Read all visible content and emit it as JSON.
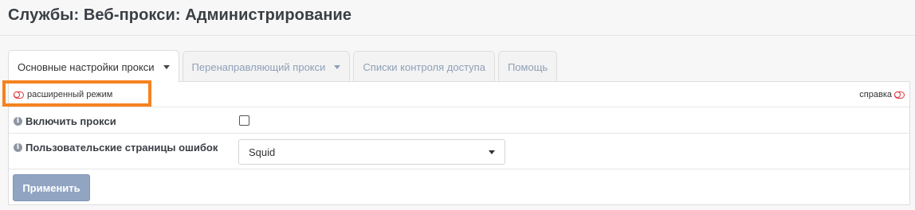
{
  "page": {
    "title": "Службы: Веб-прокси: Администрирование"
  },
  "tabs": [
    {
      "label": "Основные настройки прокси",
      "active": true,
      "has_dropdown": true
    },
    {
      "label": "Перенаправляющий прокси",
      "active": false,
      "has_dropdown": true
    },
    {
      "label": "Списки контроля доступа",
      "active": false,
      "has_dropdown": false
    },
    {
      "label": "Помощь",
      "active": false,
      "has_dropdown": false
    }
  ],
  "panel": {
    "advanced_mode_label": "расширенный режим",
    "help_label": "справка",
    "fields": {
      "enable_proxy": {
        "label": "Включить прокси",
        "checked": false
      },
      "error_pages": {
        "label": "Пользовательские страницы ошибок",
        "value": "Squid"
      }
    },
    "apply_label": "Применить"
  },
  "icons": {
    "info": "info-circle",
    "toggle": "toggle-off",
    "dropdown": "caret-down"
  },
  "colors": {
    "toggle": "#e0343a",
    "apply_button": "#91a5c3",
    "highlight": "#f5821f",
    "inactive_tab_text": "#8ea0b8"
  }
}
